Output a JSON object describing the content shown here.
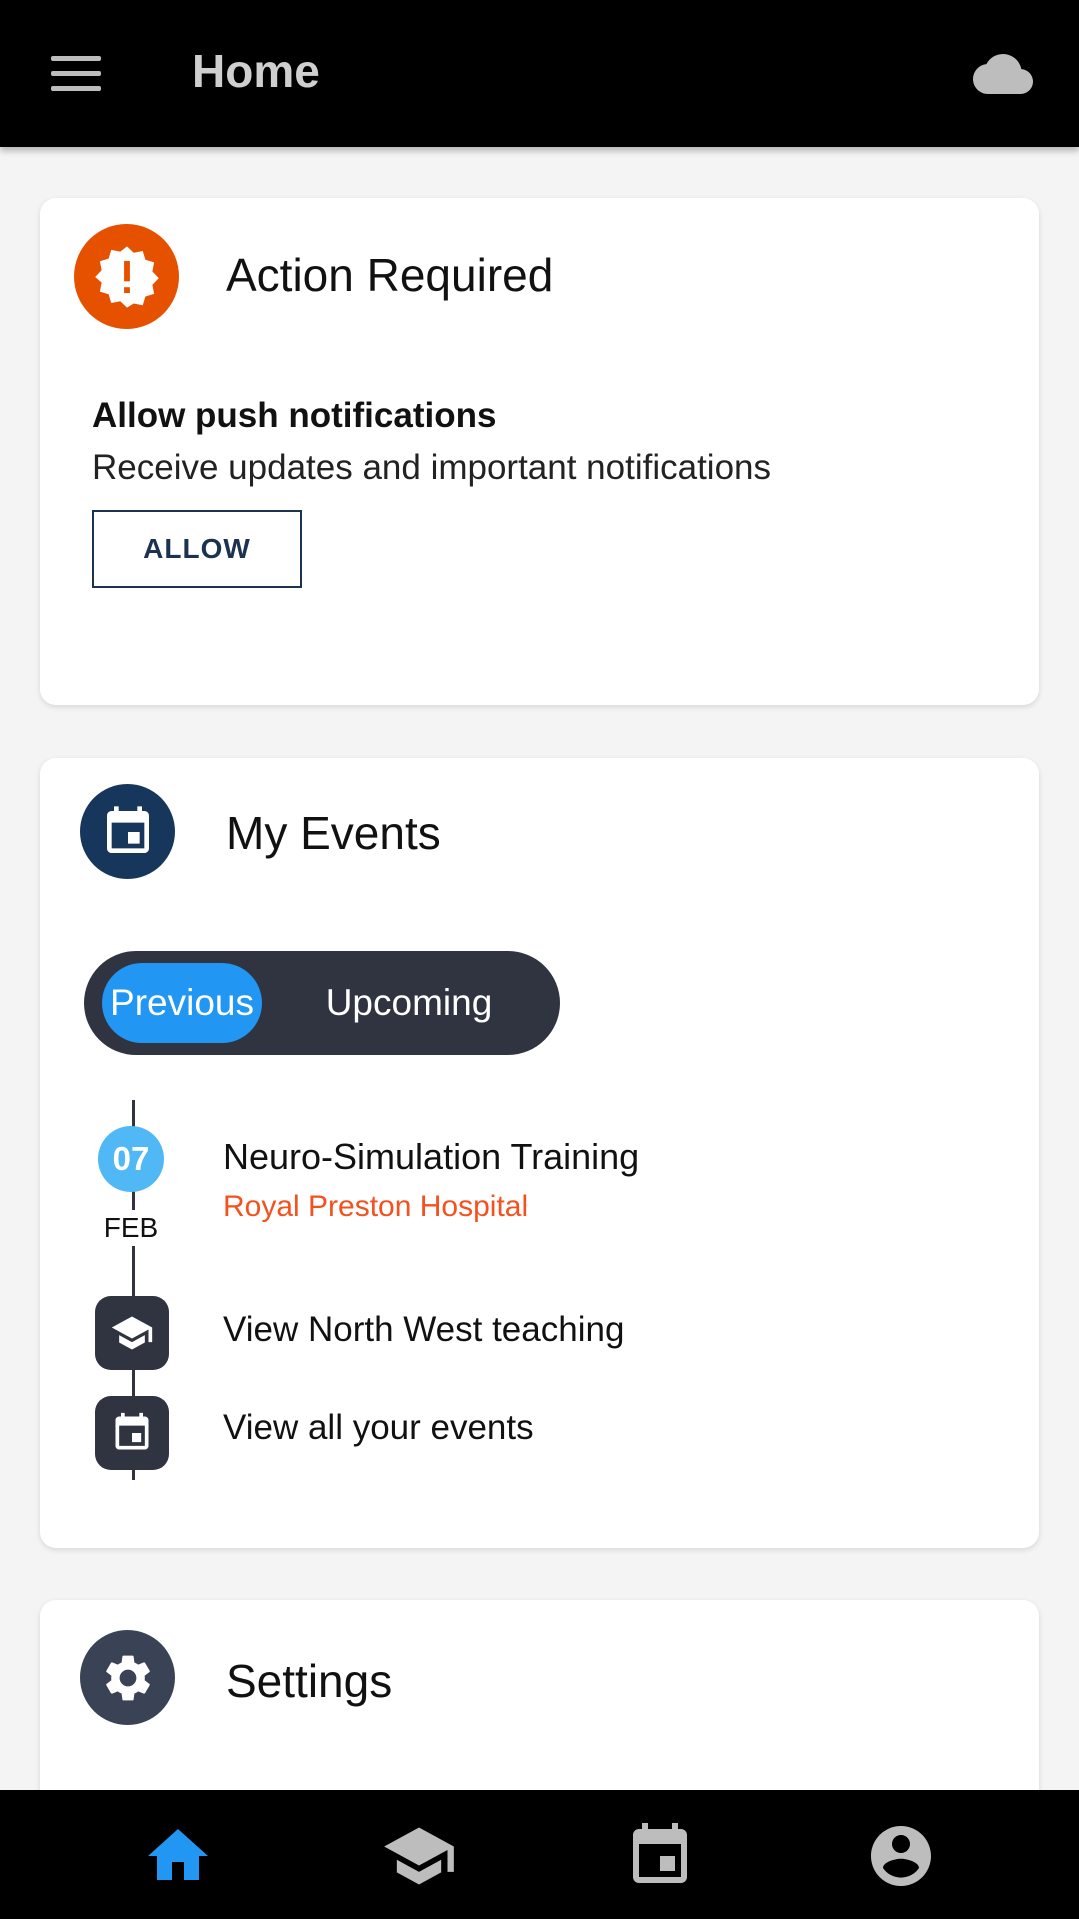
{
  "app_bar": {
    "title": "Home",
    "menu_icon": "hamburger-menu-icon",
    "status_icon": "cloud-icon"
  },
  "action_card": {
    "icon": "alert-badge-icon",
    "title": "Action Required",
    "push_title": "Allow push notifications",
    "push_desc": "Receive updates and important notifications",
    "allow_label": "ALLOW"
  },
  "events_card": {
    "icon": "calendar-icon",
    "title": "My Events",
    "toggle": {
      "previous": "Previous",
      "upcoming": "Upcoming",
      "selected": "Previous"
    },
    "event": {
      "day": "07",
      "month": "FEB",
      "title": "Neuro-Simulation Training",
      "location": "Royal Preston Hospital"
    },
    "links": {
      "teaching": "View North West teaching",
      "all_events": "View all your events"
    }
  },
  "settings_card": {
    "icon": "gear-icon",
    "title": "Settings"
  },
  "bottom_nav": {
    "items": [
      "home-icon",
      "graduation-cap-icon",
      "calendar-icon",
      "account-circle-icon"
    ],
    "active": "home-icon"
  },
  "colors": {
    "accent_blue": "#2196f3",
    "alert_orange": "#e65100",
    "navy": "#17365c",
    "location_orange": "#f4511e",
    "date_blue": "#4fb8f5"
  }
}
